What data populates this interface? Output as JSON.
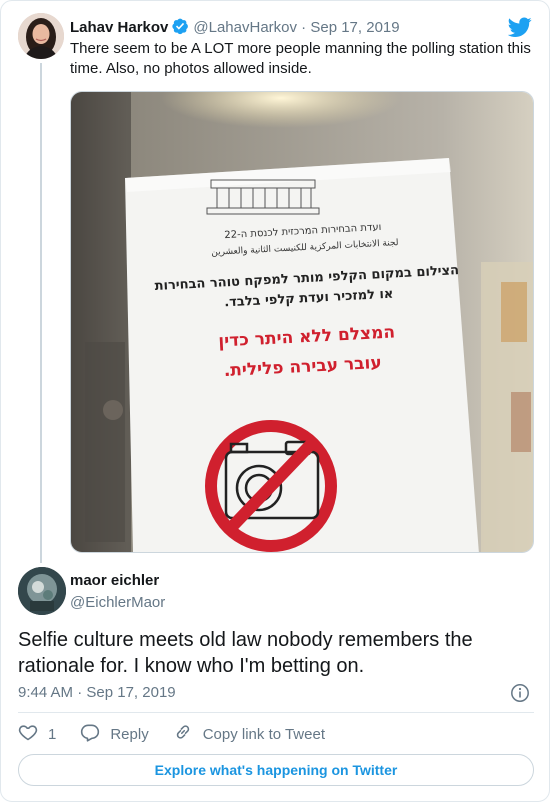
{
  "parent_tweet": {
    "name": "Lahav Harkov",
    "handle": "@LahavHarkov",
    "separator": "·",
    "date": "Sep 17, 2019",
    "text": "There seem to be A LOT more people manning the polling station this time. Also, no photos allowed inside.",
    "verified_icon": "verified-badge-icon",
    "sign": {
      "committee_line1": "ועדת הבחירות המרכזית לכנסת ה-22",
      "committee_line2": "لجنة الانتخابات المركزية للكنيست الثانية والعشرين",
      "rule_line1": "הצילום במקום הקלפי מותר למפקח טוהר הבחירות",
      "rule_line2": "או למזכיר ועדת קלפי בלבד.",
      "warn_line1": "המצלם ללא היתר כדין",
      "warn_line2": "עובר עבירה פלילית."
    }
  },
  "tweet": {
    "name": "maor eichler",
    "handle": "@EichlerMaor",
    "text": "Selfie culture meets old law nobody remembers the rationale for. I know who I'm betting on.",
    "time": "9:44 AM",
    "separator": "·",
    "date": "Sep 17, 2019"
  },
  "actions": {
    "like_count": "1",
    "reply_label": "Reply",
    "copy_link_label": "Copy link to Tweet"
  },
  "explore_label": "Explore what's happening on Twitter",
  "colors": {
    "twitter_blue": "#1da1f2",
    "link_blue": "#1b95e0",
    "secondary_text": "#657786",
    "border": "#e1e8ed",
    "sign_red": "#d0202e"
  },
  "icons": [
    "twitter-logo-icon",
    "verified-badge-icon",
    "info-icon",
    "heart-icon",
    "reply-icon",
    "link-icon",
    "no-camera-icon"
  ]
}
